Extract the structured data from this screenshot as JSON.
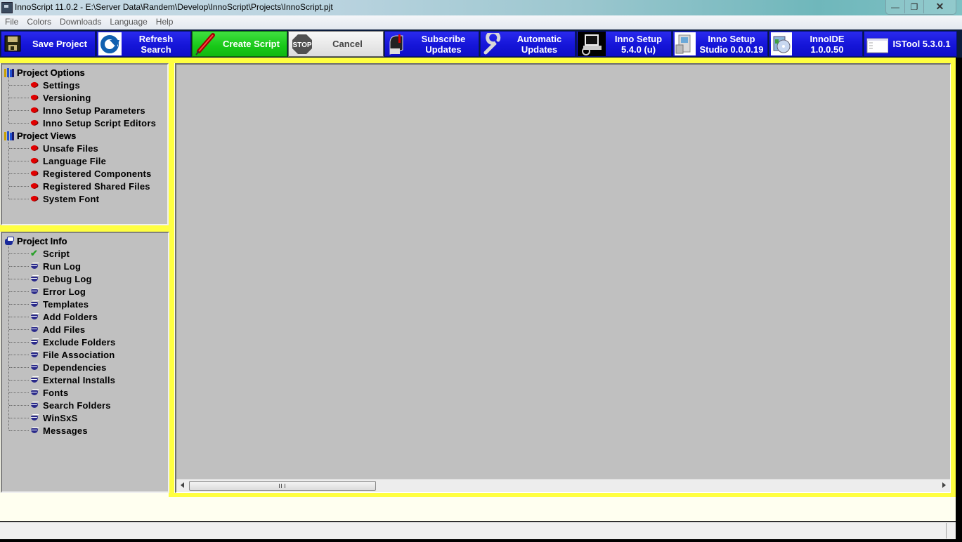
{
  "window": {
    "title": "InnoScript 11.0.2 - E:\\Server Data\\Randem\\Develop\\InnoScript\\Projects\\InnoScript.pjt",
    "controls": {
      "minimize": "—",
      "restore": "❐",
      "close": "✕"
    }
  },
  "menu": [
    "File",
    "Colors",
    "Downloads",
    "Language",
    "Help"
  ],
  "toolbar": [
    {
      "label": "Save Project",
      "icon": "floppy-disk-icon",
      "style": "blue"
    },
    {
      "label": "Refresh\nSearch",
      "icon": "refresh-icon",
      "style": "blue"
    },
    {
      "label": "Create Script",
      "icon": "pen-icon",
      "style": "green"
    },
    {
      "label": "Cancel",
      "icon": "stop-sign-icon",
      "style": "gray"
    },
    {
      "label": "Subscribe\nUpdates",
      "icon": "mailbox-icon",
      "style": "blue"
    },
    {
      "label": "Automatic\nUpdates",
      "icon": "wrench-icon",
      "style": "blue"
    },
    {
      "label": "Inno Setup\n5.4.0 (u)",
      "icon": "computer-icon",
      "style": "blue"
    },
    {
      "label": "Inno Setup\nStudio 0.0.0.19",
      "icon": "installer-box-icon",
      "style": "blue"
    },
    {
      "label": "InnoIDE\n1.0.0.50",
      "icon": "cd-install-icon",
      "style": "blue"
    },
    {
      "label": "ISTool 5.3.0.1",
      "icon": "window-icon",
      "style": "blue"
    }
  ],
  "tree_top": {
    "groups": [
      {
        "label": "Project Options",
        "icon": "books-icon",
        "items": [
          "Settings",
          "Versioning",
          "Inno Setup Parameters",
          "Inno Setup Script Editors"
        ]
      },
      {
        "label": "Project Views",
        "icon": "books-icon",
        "items": [
          "Unsafe Files",
          "Language File",
          "Registered Components",
          "Registered Shared Files",
          "System Font"
        ]
      }
    ]
  },
  "tree_bottom": {
    "label": "Project Info",
    "icon": "info-icon",
    "items": [
      {
        "label": "Script",
        "icon": "checkmark-icon"
      },
      {
        "label": "Run Log",
        "icon": "log-icon"
      },
      {
        "label": "Debug Log",
        "icon": "log-icon"
      },
      {
        "label": "Error Log",
        "icon": "log-icon"
      },
      {
        "label": "Templates",
        "icon": "log-icon"
      },
      {
        "label": "Add Folders",
        "icon": "log-icon"
      },
      {
        "label": "Add Files",
        "icon": "log-icon"
      },
      {
        "label": "Exclude Folders",
        "icon": "log-icon"
      },
      {
        "label": "File Association",
        "icon": "log-icon"
      },
      {
        "label": "Dependencies",
        "icon": "log-icon"
      },
      {
        "label": "External Installs",
        "icon": "log-icon"
      },
      {
        "label": "Fonts",
        "icon": "log-icon"
      },
      {
        "label": "Search Folders",
        "icon": "log-icon"
      },
      {
        "label": "WinSxS",
        "icon": "log-icon"
      },
      {
        "label": "Messages",
        "icon": "log-icon"
      }
    ]
  },
  "statusbar": {
    "text": ""
  },
  "colors": {
    "toolbar_blue": "#1a1ae0",
    "toolbar_green": "#20d020",
    "frame_yellow": "#ffff40",
    "panel_gray": "#c0c0c0"
  }
}
